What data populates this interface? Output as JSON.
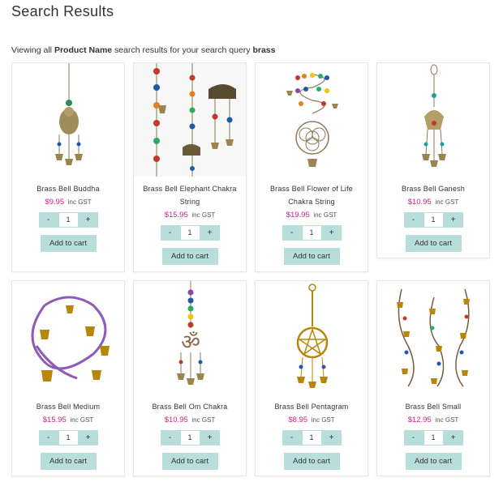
{
  "page": {
    "title": "Search Results",
    "query_prefix": "Viewing all",
    "query_field": "Product Name",
    "query_mid": "search results for your search query",
    "query_term": "brass"
  },
  "labels": {
    "tax": "inc GST",
    "add_to_cart": "Add to cart",
    "minus": "-",
    "plus": "+"
  },
  "colors": {
    "price": "#d6217e",
    "button": "#b7dedb"
  },
  "products": [
    {
      "name": "Brass Bell Buddha",
      "price": "$9.95",
      "qty": "1",
      "icon": "buddha-chime"
    },
    {
      "name": "Brass Bell Elephant Chakra String",
      "price": "$15.95",
      "qty": "1",
      "icon": "elephant-chime"
    },
    {
      "name": "Brass Bell Flower of Life Chakra String",
      "price": "$19.95",
      "qty": "1",
      "icon": "flower-of-life-chime"
    },
    {
      "name": "Brass Bell Ganesh",
      "price": "$10.95",
      "qty": "1",
      "icon": "ganesh-chime"
    },
    {
      "name": "Brass Bell Medium",
      "price": "$15.95",
      "qty": "1",
      "icon": "purple-rope-bells"
    },
    {
      "name": "Brass Bell Om Chakra",
      "price": "$10.95",
      "qty": "1",
      "icon": "om-chime"
    },
    {
      "name": "Brass Bell Pentagram",
      "price": "$8.95",
      "qty": "1",
      "icon": "pentagram-chime"
    },
    {
      "name": "Brass Bell Small",
      "price": "$12.95",
      "qty": "1",
      "icon": "small-bell-string"
    }
  ]
}
